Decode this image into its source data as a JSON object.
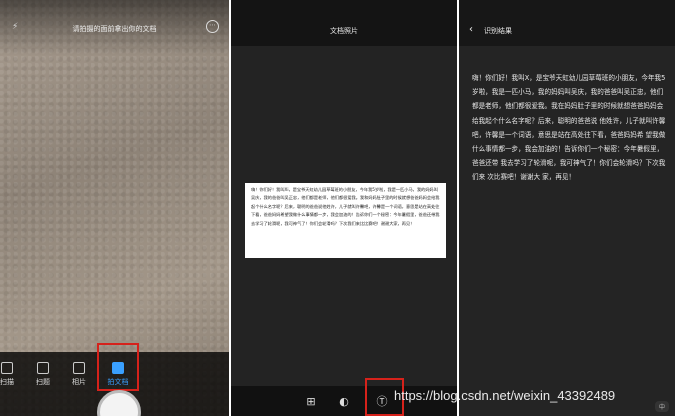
{
  "camera": {
    "hint": "请拍摄的面前拿出你的文档",
    "modes": [
      {
        "label": "扫描"
      },
      {
        "label": "扫题"
      },
      {
        "label": "相片"
      },
      {
        "label": "拍文档"
      }
    ]
  },
  "doc_photo": {
    "title": "文档照片",
    "page_text": "嗨！你们好！我叫Xi，是宝爷天虹幼儿园草莓班的小朋友，今年我5岁啦，我是一匹小马，我的妈妈叫吴庆，我的爸爸叫吴正忠，他们都是老师，他们都很爱我。我和妈妈肚子里的时候就想爸爸妈妈会给我起个什么名字呢？后来，聪明的爸爸说他姓许，儿子就叫许馨吧，许馨是一个词语，意思是站在高处往下看，爸爸妈妈希望我做什么事情都一步，我会加油的！告诉你们一个秘密：今年暑假里，爸爸还带我去学习了轮滑呢，我可神气了！你们会轮滑吗？下次我们来比比赛吧！谢谢大家，再见！"
  },
  "result": {
    "title": "识别结果",
    "text": "嗨！你们好！我叫X，是宝爷天虹幼儿园草莓班的小朋友，今年我5岁啦，我是一匹小马，我的妈妈叫吴庆，我的爸爸叫吴正忠，他们都是老师，他们都很爱我。我在妈妈肚子里的时候就想爸爸妈妈会给我起个什么名字呢？后来，聪明的爸爸说 他姓许，儿子就叫许馨吧，许馨是一个词语，意思是站在高处往下看，爸爸妈妈希 望我做什么事情都一步，我会加油的！告诉你们一个秘密：今年暑假里，爸爸还带 我去学习了轮滑呢，我可神气了！你们会轮滑吗？下次我们来 次比赛吧！谢谢大 家，再见！"
  },
  "watermark": "https://blog.csdn.net/weixin_43392489",
  "corner_badge": "中",
  "colors": {
    "highlight": "#d6221b",
    "active": "#3aa0ff"
  }
}
